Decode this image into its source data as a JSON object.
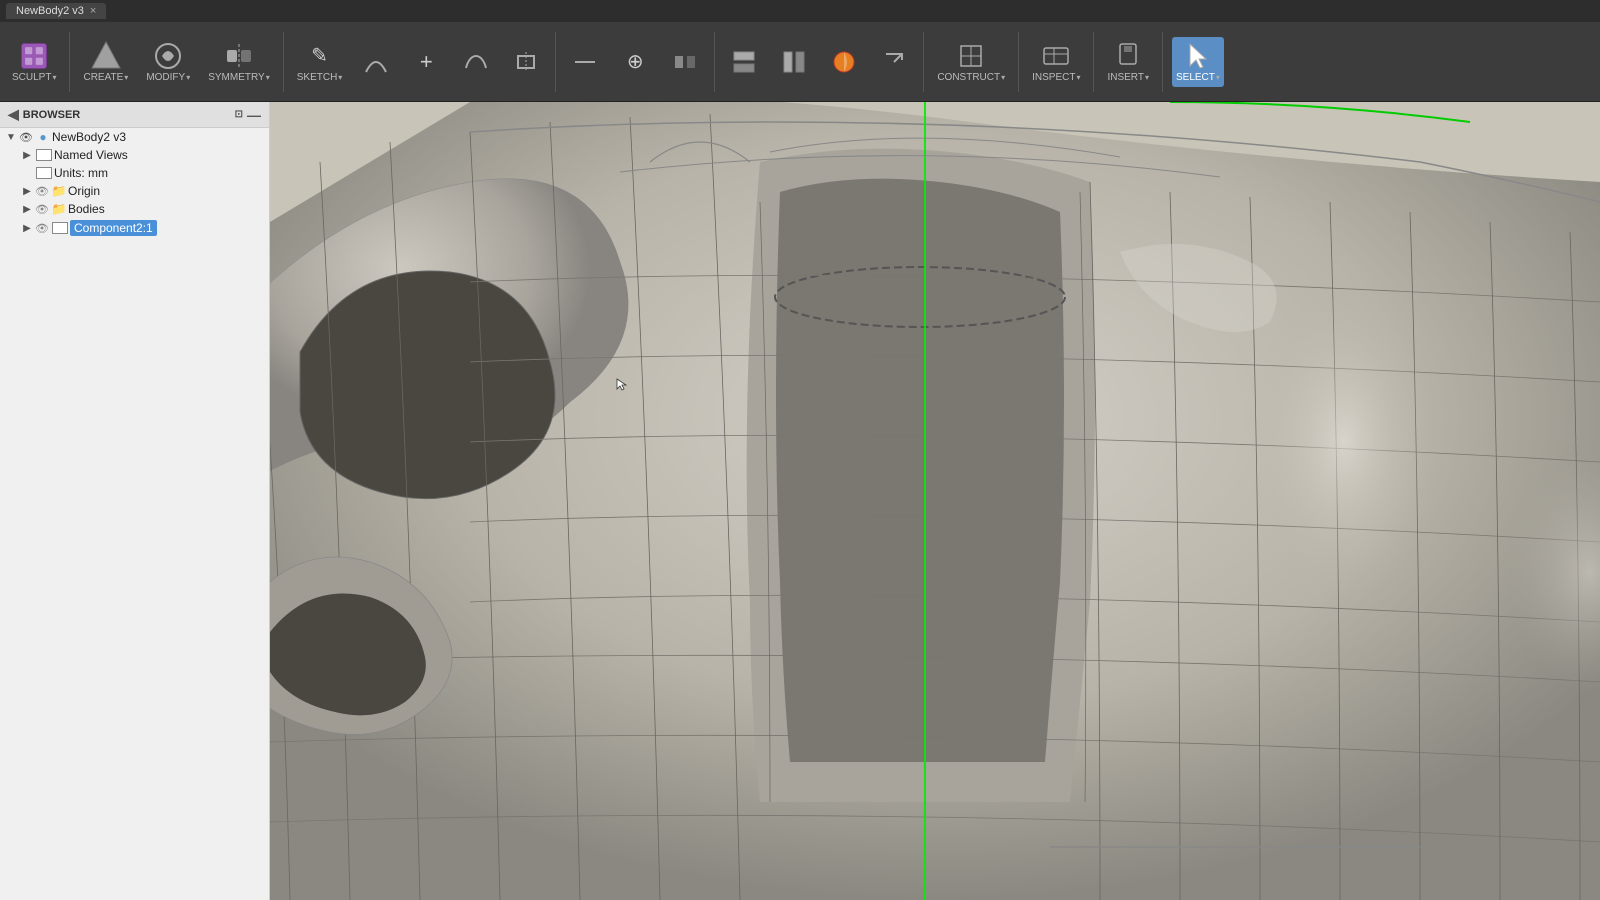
{
  "titlebar": {
    "tab_label": "NewBody2 v3",
    "close_label": "×"
  },
  "toolbar": {
    "groups": [
      {
        "id": "sculpt",
        "icon": "▣",
        "label": "SCULPT",
        "has_arrow": true
      },
      {
        "id": "create",
        "icon": "⬡",
        "label": "CREATE",
        "has_arrow": true
      },
      {
        "id": "modify",
        "icon": "✦",
        "label": "MODIFY",
        "has_arrow": true
      },
      {
        "id": "symmetry",
        "icon": "⟺",
        "label": "SYMMETRY",
        "has_arrow": true
      },
      {
        "id": "sketch",
        "icon": "△",
        "label": "SKETCH",
        "has_arrow": true
      },
      {
        "id": "construct",
        "icon": "⊞",
        "label": "CONSTRUCT",
        "has_arrow": true
      },
      {
        "id": "inspect",
        "icon": "⊙",
        "label": "INSPECT",
        "has_arrow": true
      },
      {
        "id": "insert",
        "icon": "⬇",
        "label": "INSERT",
        "has_arrow": true
      },
      {
        "id": "select",
        "icon": "↖",
        "label": "SELECT",
        "has_arrow": true,
        "active": true
      }
    ],
    "sketch_tools": [
      {
        "id": "pencil",
        "icon": "✏"
      },
      {
        "id": "arc",
        "icon": "⌒"
      },
      {
        "id": "plus",
        "icon": "+"
      },
      {
        "id": "curve",
        "icon": "∫"
      },
      {
        "id": "frame",
        "icon": "⊡"
      },
      {
        "id": "minus",
        "icon": "—"
      },
      {
        "id": "cross",
        "icon": "⊕"
      },
      {
        "id": "mirror",
        "icon": "⫼"
      },
      {
        "id": "stack1",
        "icon": "▤"
      },
      {
        "id": "stack2",
        "icon": "▦"
      },
      {
        "id": "orange",
        "icon": "◉"
      },
      {
        "id": "arrow_out",
        "icon": "↗"
      }
    ],
    "construct_tools": [
      {
        "id": "planes",
        "icon": "⊞"
      },
      {
        "id": "measure",
        "icon": "⊢"
      },
      {
        "id": "view",
        "icon": "⊡"
      },
      {
        "id": "select_btn",
        "icon": "↖",
        "active": true
      }
    ]
  },
  "browser": {
    "header_label": "BROWSER",
    "collapse_icon": "◀",
    "pin_icon": "📌",
    "expand_icon": "⊡",
    "tree": [
      {
        "level": 0,
        "has_chevron": true,
        "chevron": "▼",
        "eye": true,
        "box": true,
        "label": "NewBody2 v3",
        "icon": "🔵"
      },
      {
        "level": 1,
        "has_chevron": true,
        "chevron": "▶",
        "eye": false,
        "box": true,
        "label": "Named Views"
      },
      {
        "level": 1,
        "has_chevron": false,
        "chevron": "",
        "eye": false,
        "box": true,
        "label": "Units: mm"
      },
      {
        "level": 1,
        "has_chevron": true,
        "chevron": "▶",
        "eye": true,
        "box": false,
        "label": "Origin"
      },
      {
        "level": 1,
        "has_chevron": true,
        "chevron": "▶",
        "eye": true,
        "box": false,
        "label": "Bodies"
      },
      {
        "level": 1,
        "has_chevron": true,
        "chevron": "▶",
        "eye": true,
        "box": true,
        "label": "Component2:1",
        "selected": true
      }
    ]
  },
  "viewport": {
    "background_color": "#b8b3a8"
  },
  "colors": {
    "toolbar_bg": "#3c3c3c",
    "browser_bg": "#f0f0f0",
    "active_button": "#5b8ec4",
    "titlebar_bg": "#2d2d2d",
    "mesh_color": "#9a9590",
    "mesh_line": "#6b6560",
    "green_line": "#00ff00",
    "highlight": "#4a90d9"
  }
}
